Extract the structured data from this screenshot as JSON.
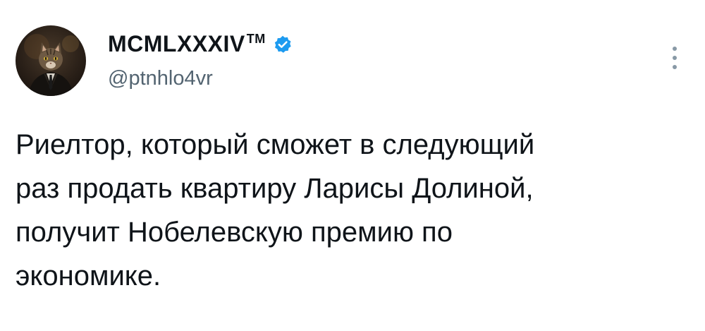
{
  "author": {
    "display_name": "MCMLXXXIV",
    "display_name_suffix": "TM",
    "handle": "@ptnhlo4vr",
    "verified": true,
    "avatar": "cat-in-suit-avatar"
  },
  "icons": {
    "verified": "verified-badge-icon",
    "more": "more-options-icon"
  },
  "tweet": {
    "lines": [
      "Риелтор, который сможет в следующий",
      "раз продать квартиру Ларисы Долиной,",
      "получит Нобелевскую премию по",
      "экономике."
    ]
  },
  "colors": {
    "verified_blue": "#1d9bf0",
    "text_primary": "#0f1419",
    "text_secondary": "#536471"
  }
}
